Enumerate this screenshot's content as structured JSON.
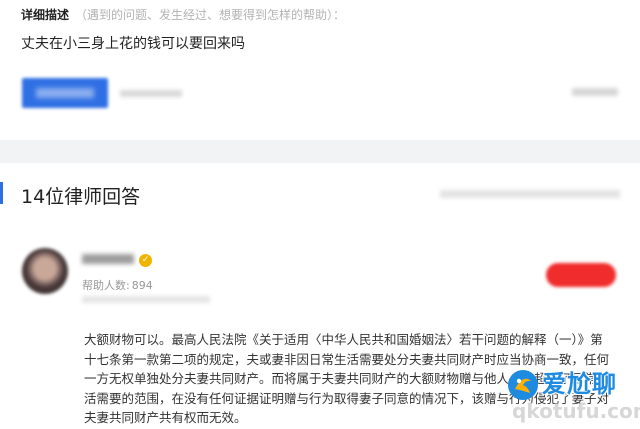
{
  "question_section": {
    "label": "详细描述",
    "hint": "（遇到的问题、发生经过、想要得到怎样的帮助）：",
    "question_text": "丈夫在小三身上花的钱可以要回来吗"
  },
  "answers_section": {
    "title": "14位律师回答"
  },
  "lawyer": {
    "badge_icon": "verified-badge-icon",
    "helped_label": "帮助人数:",
    "helped_count": "894"
  },
  "answer": {
    "text": "大额财物可以。最高人民法院《关于适用〈中华人民共和国婚姻法〉若干问题的解释（一）》第十七条第一款第二项的规定，夫或妻非因日常生活需要处分夫妻共同财产时应当协商一致，任何一方无权单独处分夫妻共同财产。而将属于夫妻共同财产的大额财物赠与他人，已超出了日常生活需要的范围，在没有任何证据证明赠与行为取得妻子同意的情况下，该赠与行为侵犯了妻子对夫妻共同财产共有权而无效。"
  },
  "watermark": {
    "cn_text": "爱尬聊",
    "url_text": "qkotufu.com",
    "color": "#1e8be0"
  },
  "colors": {
    "accent": "#2f6fe4",
    "consult_red": "#f02c2c",
    "badge_gold": "#f0b400"
  }
}
